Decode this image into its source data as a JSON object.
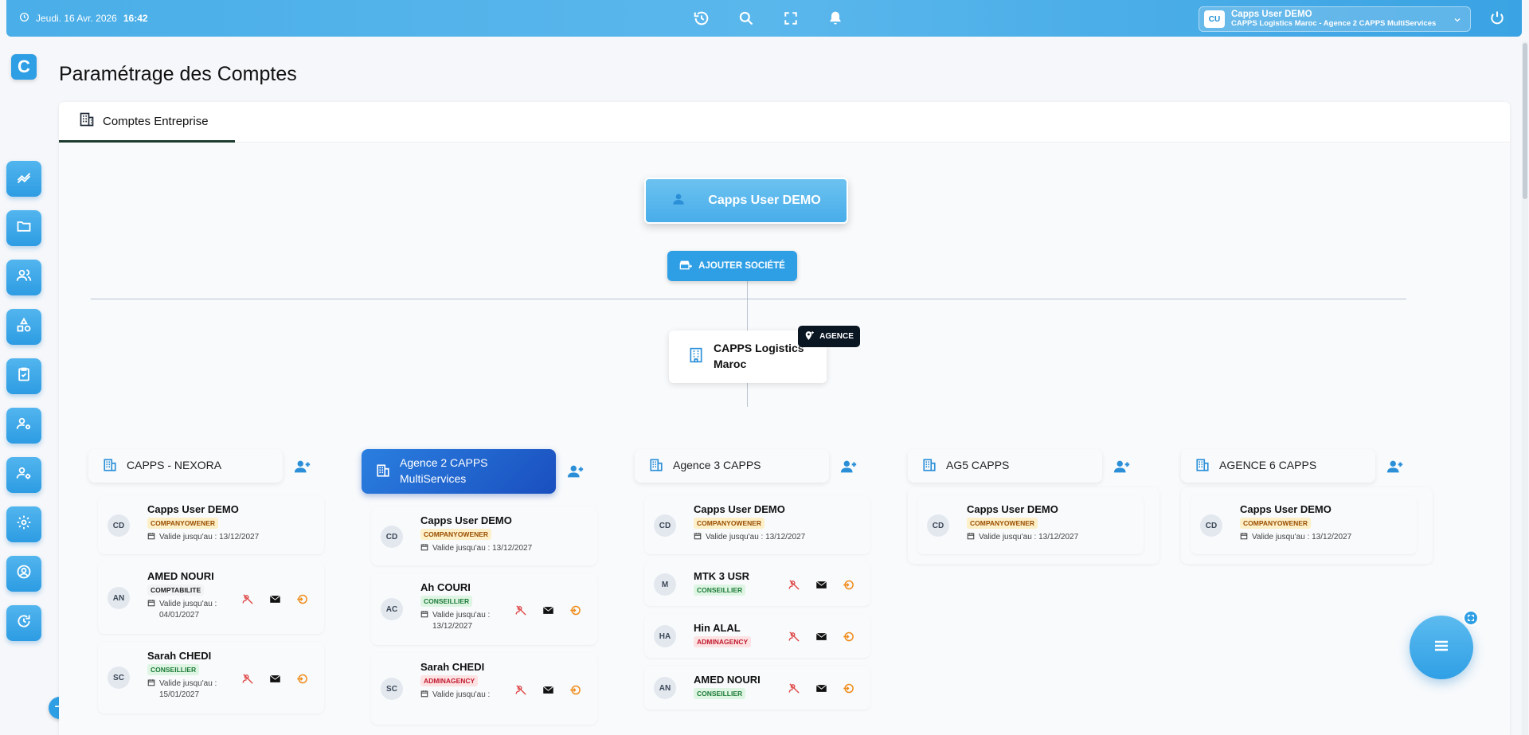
{
  "topbar": {
    "date": "Jeudi. 16 Avr. 2026",
    "time": "16:42",
    "user_initials": "CU",
    "user_name": "Capps User DEMO",
    "user_sub": "CAPPS Logistics Maroc - Agence 2 CAPPS MultiServices"
  },
  "app": {
    "logo_letter": "C"
  },
  "page": {
    "title": "Paramétrage des Comptes"
  },
  "tabs": [
    {
      "label": "Comptes Entreprise"
    }
  ],
  "tree": {
    "root": "Capps User DEMO",
    "add_company": "AJOUTER SOCIÉTÉ",
    "company_line1": "CAPPS Logistics",
    "company_line2": "Maroc",
    "company_badge": "AGENCE"
  },
  "agencies": [
    {
      "name": "CAPPS - NEXORA",
      "users": [
        {
          "initials": "CD",
          "name": "Capps User DEMO",
          "role": "COMPANYOWENER",
          "valid": "Valide jusqu'au : 13/12/2027"
        },
        {
          "initials": "AN",
          "name": "AMED NOURI",
          "role": "COMPTABILITE",
          "valid_l1": "Valide jusqu'au :",
          "valid_l2": "04/01/2027"
        },
        {
          "initials": "SC",
          "name": "Sarah CHEDI",
          "role": "CONSEILLIER",
          "valid_l1": "Valide jusqu'au :",
          "valid_l2": "15/01/2027"
        }
      ]
    },
    {
      "name_l1": "Agence 2 CAPPS",
      "name_l2": "MultiServices",
      "users": [
        {
          "initials": "CD",
          "name": "Capps User DEMO",
          "role": "COMPANYOWENER",
          "valid": "Valide jusqu'au : 13/12/2027"
        },
        {
          "initials": "AC",
          "name": "Ah COURI",
          "role": "CONSEILLIER",
          "valid_l1": "Valide jusqu'au :",
          "valid_l2": "13/12/2027"
        },
        {
          "initials": "SC",
          "name": "Sarah CHEDI",
          "role": "ADMINAGENCY",
          "valid_l1": "Valide jusqu'au :"
        }
      ]
    },
    {
      "name": "Agence 3 CAPPS",
      "users": [
        {
          "initials": "CD",
          "name": "Capps User DEMO",
          "role": "COMPANYOWENER",
          "valid": "Valide jusqu'au : 13/12/2027"
        },
        {
          "initials": "M",
          "name": "MTK 3 USR",
          "role": "CONSEILLIER"
        },
        {
          "initials": "HA",
          "name": "Hin ALAL",
          "role": "ADMINAGENCY"
        },
        {
          "initials": "AN",
          "name": "AMED NOURI",
          "role": "CONSEILLIER"
        }
      ]
    },
    {
      "name": "AG5 CAPPS",
      "users": [
        {
          "initials": "CD",
          "name": "Capps User DEMO",
          "role": "COMPANYOWENER",
          "valid": "Valide jusqu'au : 13/12/2027"
        }
      ]
    },
    {
      "name": "AGENCE 6 CAPPS",
      "users": [
        {
          "initials": "CD",
          "name": "Capps User DEMO",
          "role": "COMPANYOWENER",
          "valid": "Valide jusqu'au : 13/12/2027"
        }
      ]
    }
  ],
  "colors": {
    "accent": "#2f9fe5",
    "active_agency": "#1a4fbf",
    "owner_badge": "#fdf0c8",
    "conseiller_badge": "#dff5e4",
    "admin_badge": "#fde2e4"
  },
  "icons": [
    "clock-icon",
    "history-icon",
    "search-icon",
    "fullscreen-icon",
    "bell-icon",
    "chevron-down-icon",
    "power-icon",
    "user-icon",
    "building-icon",
    "add-user-icon",
    "calendar-icon",
    "unassign-icon",
    "mail-icon",
    "login-icon",
    "menu-icon"
  ]
}
